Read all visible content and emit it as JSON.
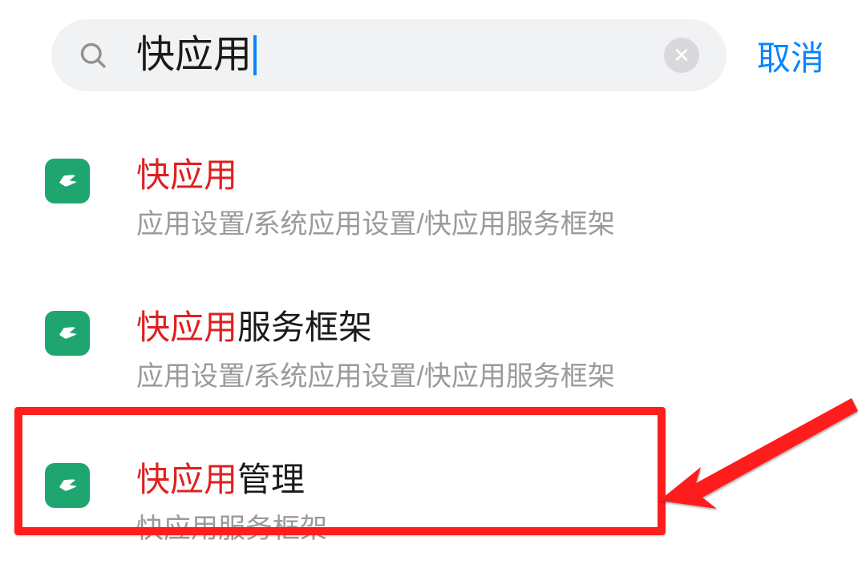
{
  "search": {
    "value": "快应用",
    "cancel_label": "取消"
  },
  "results": [
    {
      "highlight": "快应用",
      "rest": "",
      "path": "应用设置/系统应用设置/快应用服务框架"
    },
    {
      "highlight": "快应用",
      "rest": "服务框架",
      "path": "应用设置/系统应用设置/快应用服务框架"
    },
    {
      "highlight": "快应用",
      "rest": "管理",
      "path": "快应用服务框架"
    }
  ]
}
